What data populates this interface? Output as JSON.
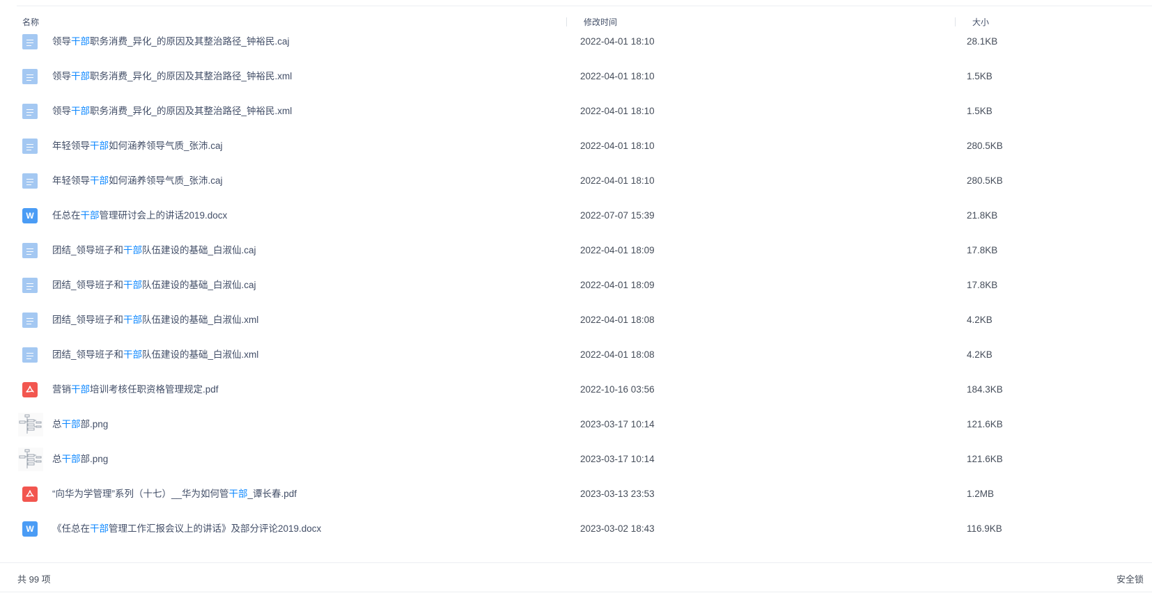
{
  "header": {
    "name": "名称",
    "modified": "修改时间",
    "size": "大小"
  },
  "files": [
    {
      "icon": "doc-icon",
      "pre": "领导",
      "kw": "干部",
      "post": "职务消费_异化_的原因及其整治路径_钟裕民.caj",
      "time": "2022-04-01 18:10",
      "size": "28.1KB"
    },
    {
      "icon": "doc-icon",
      "pre": "领导",
      "kw": "干部",
      "post": "职务消费_异化_的原因及其整治路径_钟裕民.xml",
      "time": "2022-04-01 18:10",
      "size": "1.5KB"
    },
    {
      "icon": "doc-icon",
      "pre": "领导",
      "kw": "干部",
      "post": "职务消费_异化_的原因及其整治路径_钟裕民.xml",
      "time": "2022-04-01 18:10",
      "size": "1.5KB"
    },
    {
      "icon": "doc-icon",
      "pre": "年轻领导",
      "kw": "干部",
      "post": "如何涵养领导气质_张沛.caj",
      "time": "2022-04-01 18:10",
      "size": "280.5KB"
    },
    {
      "icon": "doc-icon",
      "pre": "年轻领导",
      "kw": "干部",
      "post": "如何涵养领导气质_张沛.caj",
      "time": "2022-04-01 18:10",
      "size": "280.5KB"
    },
    {
      "icon": "word-icon",
      "pre": "任总在",
      "kw": "干部",
      "post": "管理研讨会上的讲话2019.docx",
      "time": "2022-07-07 15:39",
      "size": "21.8KB"
    },
    {
      "icon": "doc-icon",
      "pre": "团结_领导班子和",
      "kw": "干部",
      "post": "队伍建设的基础_白淑仙.caj",
      "time": "2022-04-01 18:09",
      "size": "17.8KB"
    },
    {
      "icon": "doc-icon",
      "pre": "团结_领导班子和",
      "kw": "干部",
      "post": "队伍建设的基础_白淑仙.caj",
      "time": "2022-04-01 18:09",
      "size": "17.8KB"
    },
    {
      "icon": "doc-icon",
      "pre": "团结_领导班子和",
      "kw": "干部",
      "post": "队伍建设的基础_白淑仙.xml",
      "time": "2022-04-01 18:08",
      "size": "4.2KB"
    },
    {
      "icon": "doc-icon",
      "pre": "团结_领导班子和",
      "kw": "干部",
      "post": "队伍建设的基础_白淑仙.xml",
      "time": "2022-04-01 18:08",
      "size": "4.2KB"
    },
    {
      "icon": "pdf-icon",
      "pre": "营销",
      "kw": "干部",
      "post": "培训考核任职资格管理规定.pdf",
      "time": "2022-10-16 03:56",
      "size": "184.3KB"
    },
    {
      "icon": "image-thumbnail-icon",
      "pre": "总",
      "kw": "干部",
      "post": "部.png",
      "time": "2023-03-17 10:14",
      "size": "121.6KB"
    },
    {
      "icon": "image-thumbnail-icon",
      "pre": "总",
      "kw": "干部",
      "post": "部.png",
      "time": "2023-03-17 10:14",
      "size": "121.6KB"
    },
    {
      "icon": "pdf-icon",
      "pre": "“向华为学管理”系列（十七）__华为如何管",
      "kw": "干部",
      "post": "_谭长春.pdf",
      "time": "2023-03-13 23:53",
      "size": "1.2MB"
    },
    {
      "icon": "word-icon",
      "pre": "《任总在",
      "kw": "干部",
      "post": "管理工作汇报会议上的讲话》及部分评论2019.docx",
      "time": "2023-03-02 18:43",
      "size": "116.9KB"
    }
  ],
  "footer": {
    "count": "共 99 项",
    "right": "安全锁"
  },
  "colors": {
    "keyword": "#0a86ff",
    "doc": "#a4c8f2",
    "word": "#4a9cf5",
    "pdf": "#f2564f"
  }
}
